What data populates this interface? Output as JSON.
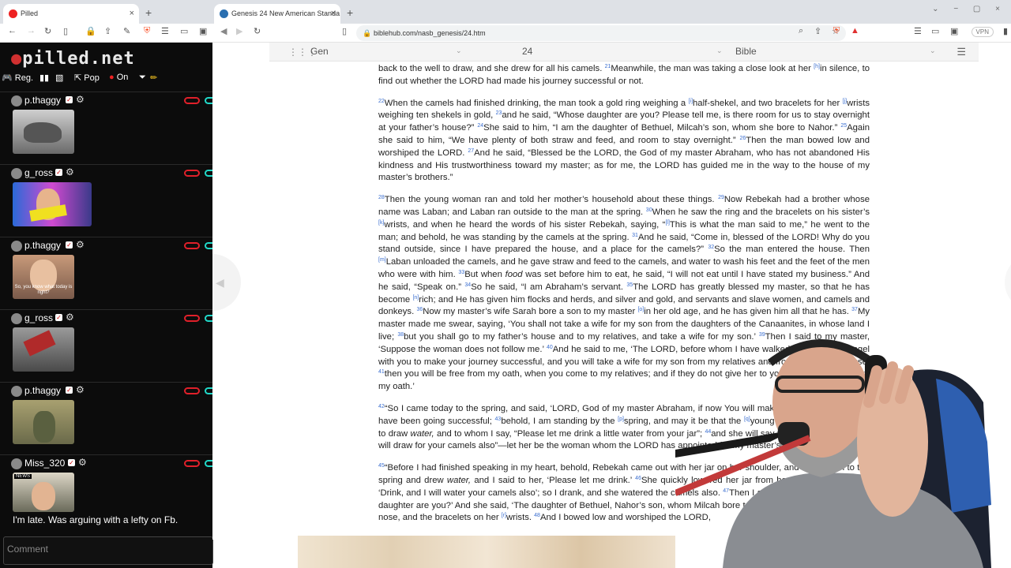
{
  "left_window": {
    "tab_title": "Pilled",
    "tab_close": "×",
    "new_tab": "+"
  },
  "right_window": {
    "tab_title": "Genesis 24 New American Standa",
    "tab_close": "×",
    "new_tab": "+",
    "url": "biblehub.com/nasb_genesis/24.htm",
    "vpn_label": "VPN"
  },
  "chat": {
    "logo_text": "pilled.net",
    "toolbar": {
      "reg": "Reg.",
      "pop": "Pop",
      "on": "On"
    },
    "messages": [
      {
        "user": "p.thaggy",
        "thumb_caption": ""
      },
      {
        "user": "g_ross",
        "thumb_caption": ""
      },
      {
        "user": "p.thaggy",
        "thumb_caption": "So, you know what today is right?"
      },
      {
        "user": "g_ross",
        "thumb_caption": ""
      },
      {
        "user": "p.thaggy",
        "thumb_caption": ""
      },
      {
        "user": "Miss_320",
        "thumb_caption": "NEWS",
        "text": "I'm late. Was arguing with a lefty on Fb."
      }
    ],
    "comment_placeholder": "Comment"
  },
  "bible": {
    "book": "Gen",
    "chapter": "24",
    "version": "Bible",
    "paragraphs": [
      "back to the well to draw, and she drew for all his camels. <sup>21</sup>Meanwhile, the man was taking a close look at her <sup>[h]</sup>in silence, to find out whether the LORD had made his journey successful or not.",
      "<sup>22</sup>When the camels had finished drinking, the man took a gold ring weighing a <sup>[i]</sup>half-shekel, and two bracelets for her <sup>[j]</sup>wrists weighing ten shekels in gold, <sup>23</sup>and he said, “Whose daughter are you? Please tell me, is there room for us to stay overnight at your father’s house?” <sup>24</sup>She said to him, “I am the daughter of Bethuel, Milcah’s son, whom she bore to Nahor.” <sup>25</sup>Again she said to him, “We have plenty of both straw and feed, and room to stay overnight.” <sup>26</sup>Then the man bowed low and worshiped the LORD. <sup>27</sup>And he said, “Blessed be the LORD, the God of my master Abraham, who has not abandoned His kindness and His trustworthiness toward my master; as for me, the LORD has guided me in the way to the house of my master’s brothers.”",
      "<sup>28</sup>Then the young woman ran and told her mother’s household about these things. <sup>29</sup>Now Rebekah had a brother whose name was Laban; and Laban ran outside to the man at the spring. <sup>30</sup>When he saw the ring and the bracelets on his sister’s <sup>[k]</sup>wrists, and when he heard the words of his sister Rebekah, saying, “<sup>[l]</sup>This is what the man said to me,” he went to the man; and behold, he was standing by the camels at the spring. <sup>31</sup>And he said, “Come in, blessed of the LORD! Why do you stand outside, since I have prepared the house, and a place for the camels?” <sup>32</sup>So the man entered the house. Then <sup>[m]</sup>Laban unloaded the camels, and he gave straw and feed to the camels, and water to wash his feet and the feet of the men who were with him. <sup>33</sup>But when <i>food</i> was set before him to eat, he said, “I will not eat until I have stated my business.” And he said, “Speak on.” <sup>34</sup>So he said, “I am Abraham’s servant. <sup>35</sup>The LORD has greatly blessed my master, so that he has become <sup>[n]</sup>rich; and He has given him flocks and herds, and silver and gold, and servants and slave women, and camels and donkeys. <sup>36</sup>Now my master’s wife Sarah bore a son to my master <sup>[o]</sup>in her old age, and he has given him all that he has. <sup>37</sup>My master made me swear, saying, ‘You shall not take a wife for my son from the daughters of the Canaanites, in whose land I live; <sup>38</sup>but you shall go to my father’s house and to my relatives, and take a wife for my son.’ <sup>39</sup>Then I said to my master, ‘Suppose the woman does not follow me.’ <sup>40</sup>And he said to me, ‘The LORD, before whom I have walked, will send His angel with you to make your journey successful, and you will take a wife for my son from my relatives and from my father’s house; <sup>41</sup>then you will be free from my oath, when you come to my relatives; and if they do not give her to you, you will be free from my oath.’",
      "<sup>42</sup>“So I came today to the spring, and said, ‘LORD, God of my master Abraham, if now You will make my journey on which I have been going successful; <sup>43</sup>behold, I am standing by the <sup>[p]</sup>spring, and may it be that the <sup>[q]</sup>young woman who comes out to draw <i>water,</i> and to whom I say, “Please let me drink a little water from your jar”; <sup>44</sup>and she will say to me, “You drink, and I will draw for your camels also”—let her be the woman whom the LORD has appointed for my master’s son.’",
      "<sup>45</sup>“Before I had finished speaking in my heart, behold, Rebekah came out with her jar on her shoulder, and went down to the spring and drew <i>water,</i> and I said to her, ‘Please let me drink.’ <sup>46</sup>She quickly lowered her jar from her shoulder, and said, ‘Drink, and I will water your camels also’; so I drank, and she watered the camels also. <sup>47</sup>Then I asked her, and said, ‘Whose daughter are you?’ And she said, ‘The daughter of Bethuel, Nahor’s son, whom Milcah bore to him’; and I put the ring on her nose, and the bracelets on her <sup>[r]</sup>wrists. <sup>48</sup>And I bowed low and worshiped the LORD,"
    ]
  }
}
